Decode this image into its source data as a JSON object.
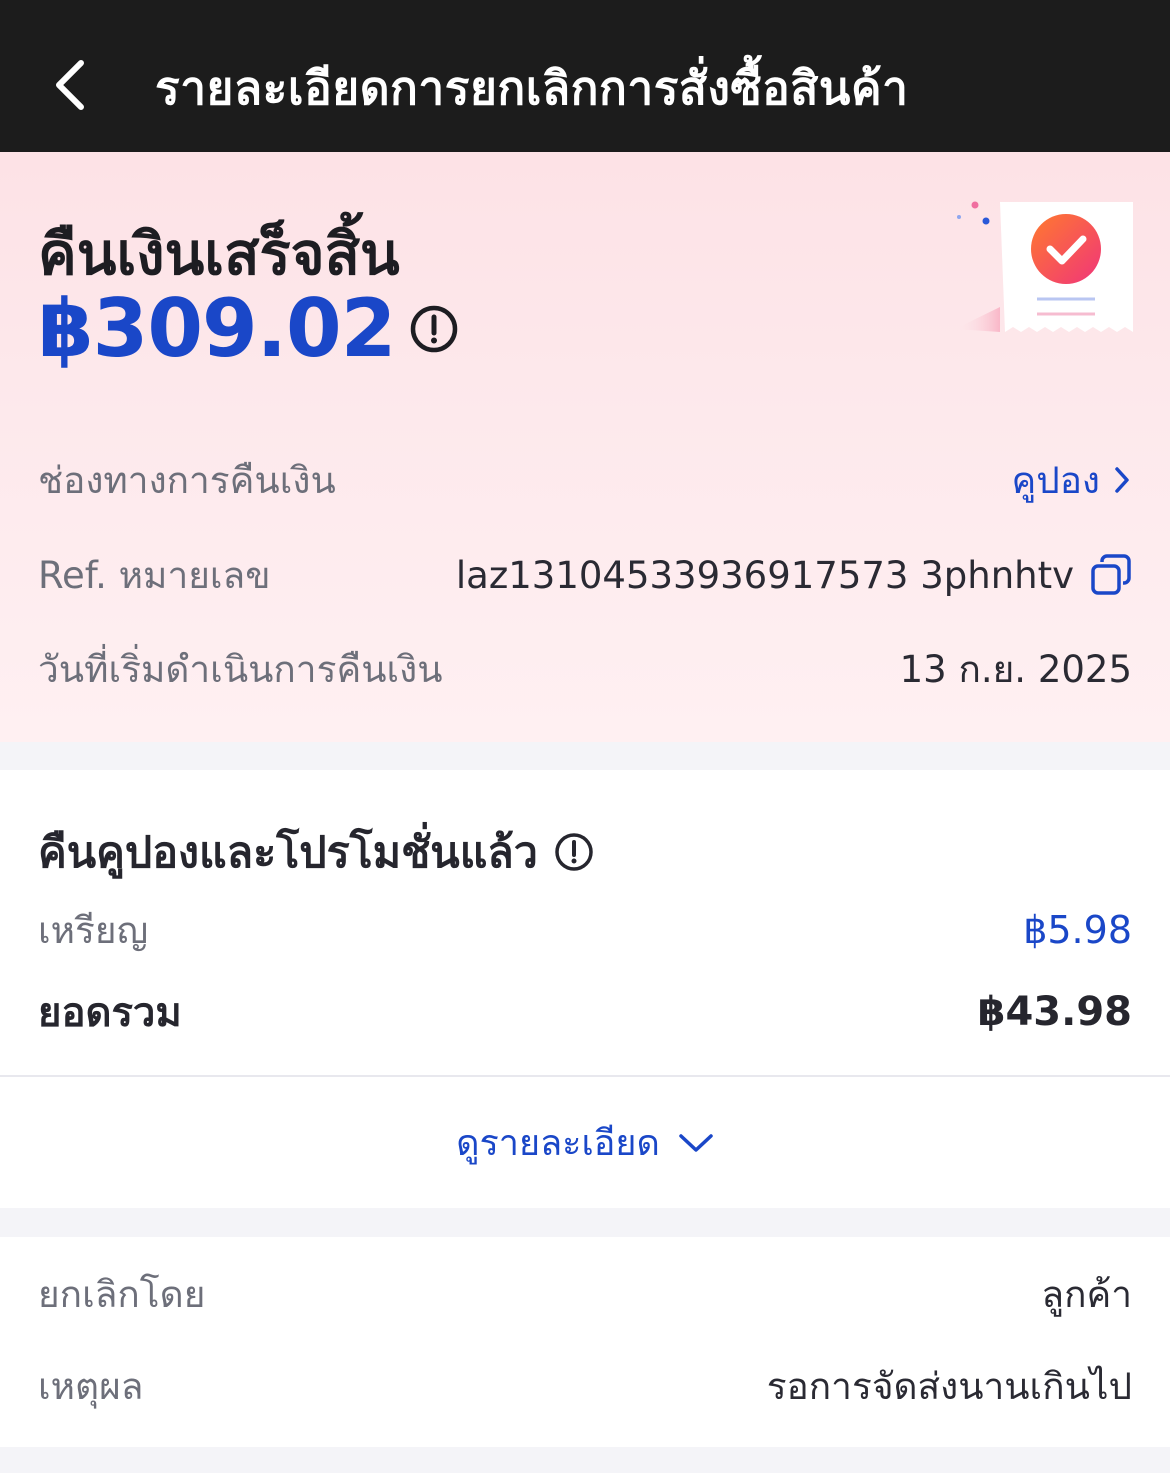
{
  "header": {
    "title": "รายละเอียดการยกเลิกการสั่งซื้อสินค้า",
    "back_icon": "chevron-left-icon"
  },
  "refund": {
    "status": "คืนเงินเสร็จสิ้น",
    "amount": "฿309.02",
    "info_icon": "info-circle-icon",
    "illustration": "receipt-check-icon"
  },
  "refund_details": {
    "channel_label": "ช่องทางการคืนเงิน",
    "channel_value": "คูปอง",
    "ref_label": "Ref. หมายเลข",
    "ref_value": "laz13104533936917573 3phnhtv",
    "date_label": "วันที่เริ่มดำเนินการคืนเงิน",
    "date_value": "13 ก.ย. 2025"
  },
  "coupons": {
    "title": "คืนคูปองและโปรโมชั่นแล้ว",
    "coin_label": "เหรียญ",
    "coin_value": "฿5.98",
    "total_label": "ยอดรวม",
    "total_value": "฿43.98",
    "details_label": "ดูรายละเอียด"
  },
  "cancellation": {
    "by_label": "ยกเลิกโดย",
    "by_value": "ลูกค้า",
    "reason_label": "เหตุผล",
    "reason_value": "รอการจัดส่งนานเกินไป"
  },
  "colors": {
    "accent": "#1a47c8",
    "header_bg": "#1c1c1c",
    "hero_bg": "#fde2e6"
  }
}
